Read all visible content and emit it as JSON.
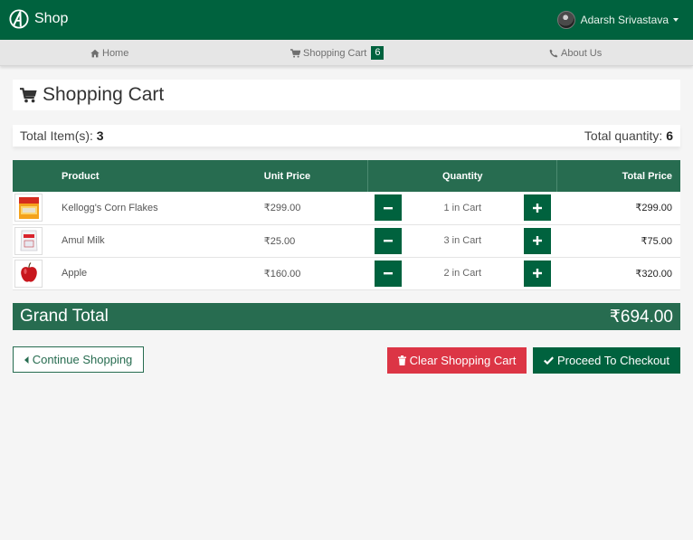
{
  "header": {
    "brand": "Shop",
    "user_name": "Adarsh Srivastava"
  },
  "nav": {
    "home": "Home",
    "cart": "Shopping Cart",
    "cart_count": "6",
    "about": "About Us"
  },
  "page": {
    "title": "Shopping Cart"
  },
  "summary": {
    "items_label": "Total Item(s):",
    "items_value": "3",
    "quantity_label": "Total quantity:",
    "quantity_value": "6"
  },
  "table": {
    "headers": {
      "product": "Product",
      "unit_price": "Unit Price",
      "quantity": "Quantity",
      "total_price": "Total Price"
    },
    "rows": [
      {
        "product": "Kellogg's Corn Flakes",
        "unit_price": "₹299.00",
        "quantity": "1 in Cart",
        "total": "₹299.00",
        "image_icon": "cornflakes-box-icon"
      },
      {
        "product": "Amul Milk",
        "unit_price": "₹25.00",
        "quantity": "3 in Cart",
        "total": "₹75.00",
        "image_icon": "milk-pouch-icon"
      },
      {
        "product": "Apple",
        "unit_price": "₹160.00",
        "quantity": "2 in Cart",
        "total": "₹320.00",
        "image_icon": "apple-icon"
      }
    ]
  },
  "grand_total": {
    "label": "Grand Total",
    "value": "₹694.00"
  },
  "actions": {
    "continue": "Continue Shopping",
    "clear": "Clear Shopping Cart",
    "checkout": "Proceed To Checkout"
  },
  "colors": {
    "primary": "#00623e",
    "header_row": "#276c50",
    "danger": "#dc3545",
    "background": "#f5f5f5"
  }
}
